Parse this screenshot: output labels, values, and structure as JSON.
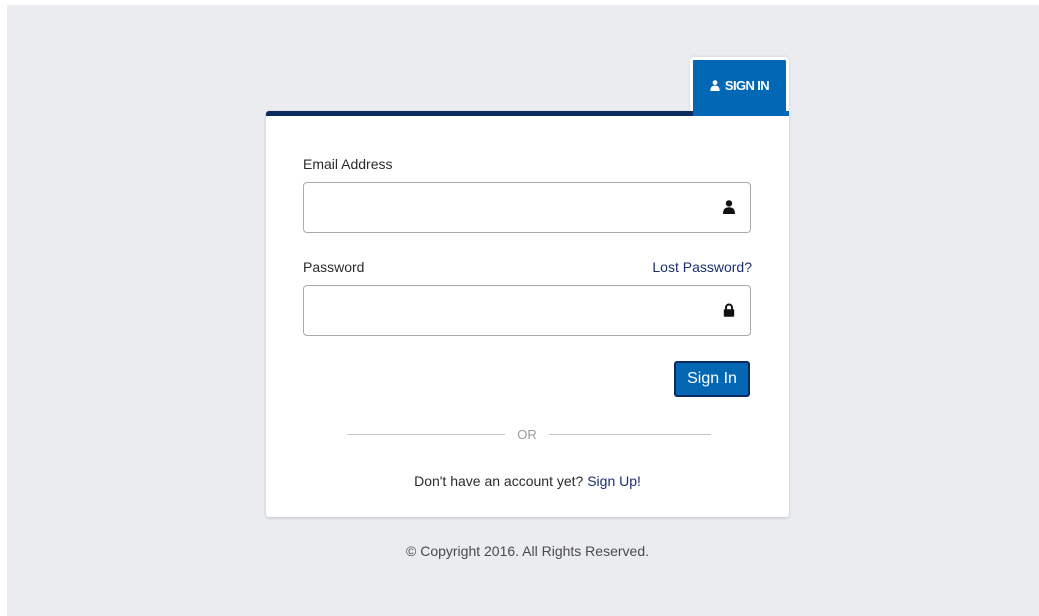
{
  "tab": {
    "label": "SIGN IN",
    "icon": "user-icon"
  },
  "form": {
    "email_label": "Email Address",
    "email_value": "",
    "email_icon": "user-icon",
    "password_label": "Password",
    "password_value": "",
    "password_icon": "lock-icon",
    "lost_password": "Lost Password?",
    "submit_label": "Sign In"
  },
  "divider": {
    "text": "OR"
  },
  "signup": {
    "prompt": "Don't have an account yet?",
    "link": "Sign Up!"
  },
  "footer": {
    "copyright": "© Copyright 2016. All Rights Reserved."
  },
  "colors": {
    "background": "#ebecf0",
    "accent": "#0268b5",
    "navy": "#0b2a5e",
    "link": "#1a2f6c"
  }
}
